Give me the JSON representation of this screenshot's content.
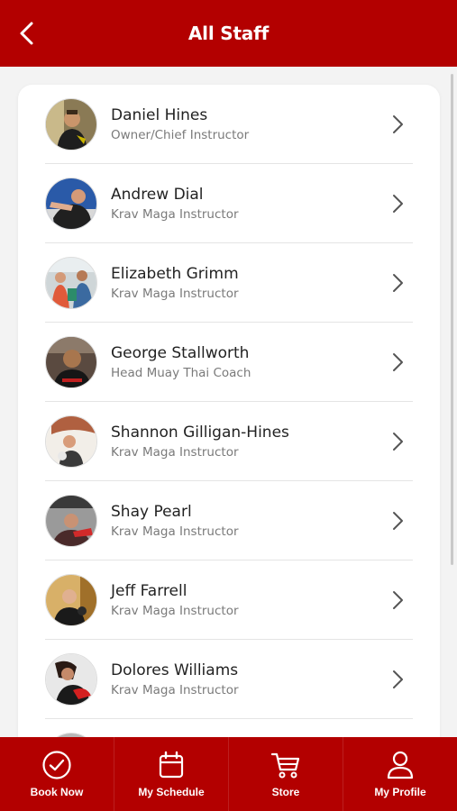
{
  "header": {
    "title": "All Staff",
    "back_icon": "chevron-left-icon"
  },
  "staff": [
    {
      "name": "Daniel Hines",
      "role": "Owner/Chief Instructor"
    },
    {
      "name": "Andrew Dial",
      "role": "Krav Maga Instructor"
    },
    {
      "name": "Elizabeth Grimm",
      "role": "Krav Maga Instructor"
    },
    {
      "name": "George Stallworth",
      "role": "Head Muay Thai Coach"
    },
    {
      "name": "Shannon Gilligan-Hines",
      "role": "Krav Maga Instructor"
    },
    {
      "name": "Shay Pearl",
      "role": "Krav Maga Instructor"
    },
    {
      "name": "Jeff Farrell",
      "role": "Krav Maga Instructor"
    },
    {
      "name": "Dolores Williams",
      "role": "Krav Maga Instructor"
    }
  ],
  "bottom_nav": [
    {
      "label": "Book Now",
      "icon": "check-circle-icon"
    },
    {
      "label": "My Schedule",
      "icon": "calendar-icon"
    },
    {
      "label": "Store",
      "icon": "cart-icon"
    },
    {
      "label": "My Profile",
      "icon": "user-icon"
    }
  ],
  "colors": {
    "brand_red": "#b30000",
    "text_primary": "#222222",
    "text_secondary": "#7a7a7a"
  }
}
